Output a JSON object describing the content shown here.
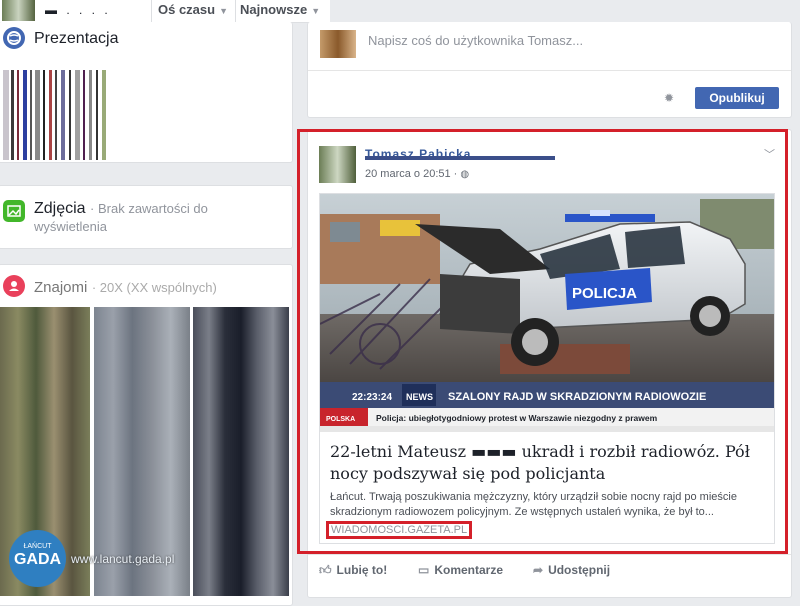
{
  "topbar": {
    "name": "▬ . . . .",
    "filter_time": "Oś czasu",
    "filter_sort": "Najnowsze"
  },
  "left": {
    "presentation_title": "Prezentacja",
    "photos_title": "Zdjęcia",
    "photos_empty": "· Brak zawartości do wyświetlenia",
    "friends_title": "Znajomi",
    "friends_sub": "· 20X (XX wspólnych)"
  },
  "composer": {
    "placeholder": "Napisz coś do użytkownika Tomasz...",
    "publish_label": "Opublikuj"
  },
  "post": {
    "author": "Tomasz Pabicka",
    "time": "20 marca o 20:51 ·",
    "link_title": "22-letni Mateusz ▬▬▬ ukradł i rozbił radiowóz. Pół nocy podszywał się pod policjanta",
    "link_desc": "Łańcut. Trwają poszukiwania mężczyzny, który urządził sobie nocny rajd po mieście skradzionym radiowozem policyjnym. Ze wstępnych ustaleń wynika, że był to...",
    "link_source": "WIADOMOSCI.GAZETA.PL",
    "image_texts": {
      "car_door": "POLICJA",
      "ticker_time": "22:23:24",
      "news_logo": "NEWS",
      "ticker_headline": "SZALONY RAJD W SKRADZIONYM RADIOWOZIE",
      "channel": "POLSKA",
      "ticker_sub": "Policja: ubiegłotygodniowy protest w Warszawie niezgodny z prawem"
    }
  },
  "actions": {
    "like": "Lubię to!",
    "comment": "Komentarze",
    "share": "Udostępnij"
  },
  "watermark": {
    "small": "ŁAŃCUT",
    "big": "GADA",
    "url": "www.lancut.gada.pl"
  },
  "colors": {
    "accent": "#4267b2",
    "highlight_red": "#d4202a",
    "background": "#e9ebee"
  }
}
